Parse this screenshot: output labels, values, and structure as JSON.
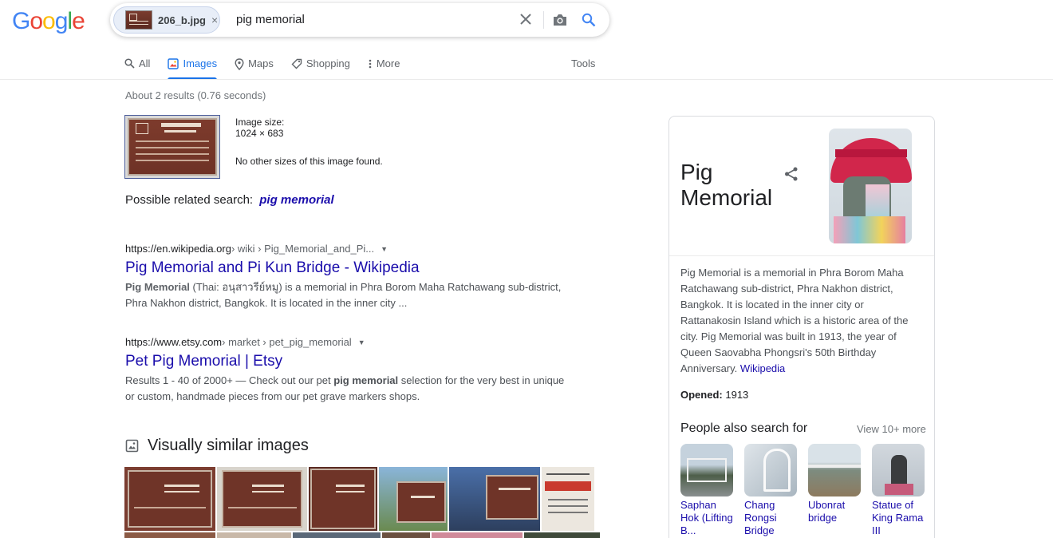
{
  "logo": {
    "letters": [
      "G",
      "o",
      "o",
      "g",
      "l",
      "e"
    ],
    "colors": [
      "#4285F4",
      "#EA4335",
      "#FBBC05",
      "#4285F4",
      "#34A853",
      "#EA4335"
    ]
  },
  "search": {
    "chip_filename": "206_b.jpg",
    "chip_remove": "×",
    "query": "pig memorial"
  },
  "tabs": [
    {
      "label": "All",
      "icon": "search-icon",
      "active": false
    },
    {
      "label": "Images",
      "icon": "image-icon",
      "active": true
    },
    {
      "label": "Maps",
      "icon": "map-pin-icon",
      "active": false
    },
    {
      "label": "Shopping",
      "icon": "tag-icon",
      "active": false
    },
    {
      "label": "More",
      "icon": "more-vertical-icon",
      "active": false
    }
  ],
  "tools_label": "Tools",
  "result_stats": "About 2 results (0.76 seconds)",
  "image_info": {
    "size_label": "Image size:",
    "size_value": "1024 × 683",
    "no_other": "No other sizes of this image found."
  },
  "related": {
    "prefix": "Possible related search:",
    "term": "pig memorial"
  },
  "results": [
    {
      "domain": "https://en.wikipedia.org",
      "path": " › wiki › Pig_Memorial_and_Pi...",
      "title": "Pig Memorial and Pi Kun Bridge - Wikipedia",
      "snippet_bold": "Pig Memorial",
      "snippet": " (Thai: อนุสาวรีย์หมู) is a memorial in Phra Borom Maha Ratchawang sub-district, Phra Nakhon district, Bangkok. It is located in the inner city ..."
    },
    {
      "domain": "https://www.etsy.com",
      "path": " › market › pet_pig_memorial",
      "title": "Pet Pig Memorial | Etsy",
      "snippet_pre": "Results 1 - 40 of 2000+ — Check out our pet ",
      "snippet_bold": "pig memorial",
      "snippet_post": " selection for the very best in unique or custom, handmade pieces from our pet grave markers shops."
    }
  ],
  "visually_similar": {
    "heading": "Visually similar images",
    "thumbs": [
      {
        "width": 114,
        "bg": "#7b3d30"
      },
      {
        "width": 113,
        "bg": "#7a3a2c"
      },
      {
        "width": 86,
        "bg": "#6d3326"
      },
      {
        "width": 86,
        "bg": "#7d5a3a"
      },
      {
        "width": 114,
        "bg": "#3e5a86"
      },
      {
        "width": 66,
        "bg": "#e8e3dc"
      }
    ]
  },
  "knowledge_panel": {
    "title": "Pig Memorial",
    "description": "Pig Memorial is a memorial in Phra Borom Maha Ratchawang sub-district, Phra Nakhon district, Bangkok. It is located in the inner city or Rattanakosin Island which is a historic area of the city. Pig Memorial was built in 1913, the year of Queen Saovabha Phongsri's 50th Birthday Anniversary.",
    "source_link": "Wikipedia",
    "opened_label": "Opened:",
    "opened_value": "1913",
    "people_also_search": {
      "heading": "People also search for",
      "more": "View 10+ more",
      "items": [
        {
          "label": "Saphan Hok (Lifting B...",
          "bg": "#8fa3b4"
        },
        {
          "label": "Chang Rongsi Bridge",
          "bg": "#c9d3dc"
        },
        {
          "label": "Ubonrat bridge",
          "bg": "#7f8d86"
        },
        {
          "label": "Statue of King Rama III",
          "bg": "#a9b2bc"
        }
      ]
    }
  }
}
